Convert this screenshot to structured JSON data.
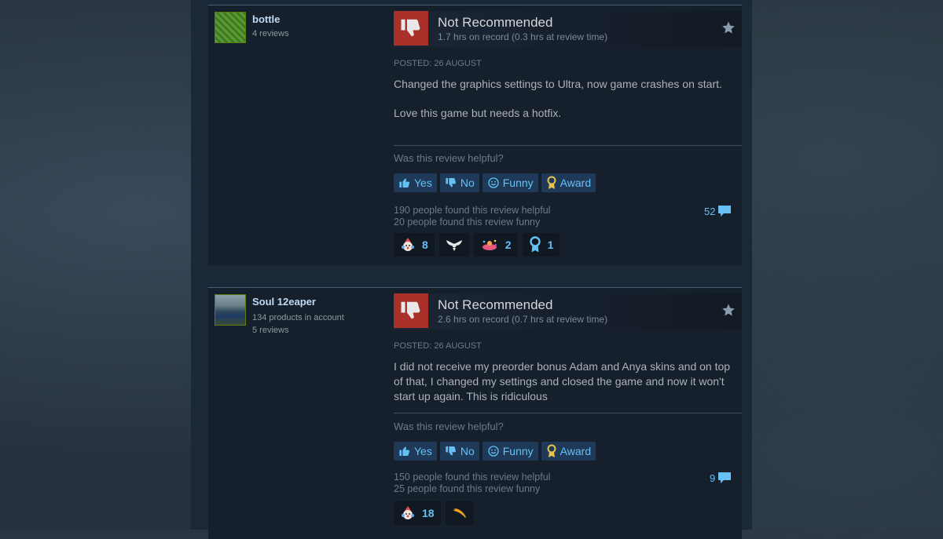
{
  "reviews": [
    {
      "author": {
        "name": "bottle",
        "lines": [
          "4 reviews"
        ]
      },
      "verdict": "Not Recommended",
      "hours": "1.7 hrs on record (0.3 hrs at review time)",
      "posted": "POSTED: 26 AUGUST",
      "paragraphs": [
        "Changed the graphics settings to Ultra, now game crashes on start.",
        "Love this game but needs a hotfix."
      ],
      "helpful_question": "Was this review helpful?",
      "buttons": {
        "yes": "Yes",
        "no": "No",
        "funny": "Funny",
        "award": "Award"
      },
      "helpful_count": "190 people found this review helpful",
      "funny_count": "20 people found this review funny",
      "comment_count": "52",
      "awards": [
        {
          "icon": "clown-award-icon",
          "count": "8"
        },
        {
          "icon": "wings-award-icon",
          "count": ""
        },
        {
          "icon": "party-award-icon",
          "count": "2"
        },
        {
          "icon": "ribbon-award-icon",
          "count": "1"
        }
      ]
    },
    {
      "author": {
        "name": "Soul 12eaper",
        "lines": [
          "134 products in account",
          "5 reviews"
        ]
      },
      "verdict": "Not Recommended",
      "hours": "2.6 hrs on record (0.7 hrs at review time)",
      "posted": "POSTED: 26 AUGUST",
      "paragraphs": [
        "I did not receive my preorder bonus Adam and Anya skins and on top of that, I changed my settings and closed the game and now it won't start up again. This is ridiculous"
      ],
      "helpful_question": "Was this review helpful?",
      "buttons": {
        "yes": "Yes",
        "no": "No",
        "funny": "Funny",
        "award": "Award"
      },
      "helpful_count": "150 people found this review helpful",
      "funny_count": "25 people found this review funny",
      "comment_count": "9",
      "awards": [
        {
          "icon": "clown-award-icon",
          "count": "18"
        },
        {
          "icon": "banana-award-icon",
          "count": ""
        }
      ]
    }
  ],
  "colors": {
    "link": "#66c0f4",
    "thumb_bg": "#a8312a",
    "panel": "#16202d"
  }
}
